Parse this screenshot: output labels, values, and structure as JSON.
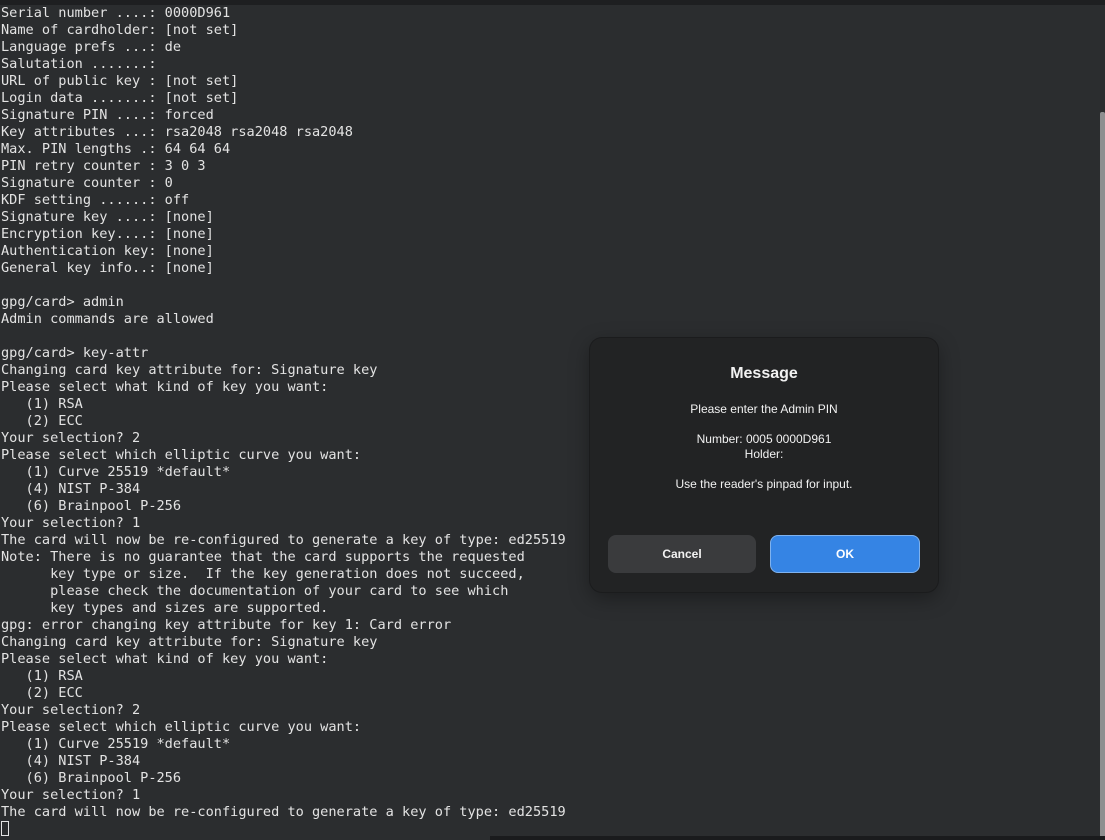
{
  "terminal": {
    "lines": [
      "Serial number ....: 0000D961",
      "Name of cardholder: [not set]",
      "Language prefs ...: de",
      "Salutation .......: ",
      "URL of public key : [not set]",
      "Login data .......: [not set]",
      "Signature PIN ....: forced",
      "Key attributes ...: rsa2048 rsa2048 rsa2048",
      "Max. PIN lengths .: 64 64 64",
      "PIN retry counter : 3 0 3",
      "Signature counter : 0",
      "KDF setting ......: off",
      "Signature key ....: [none]",
      "Encryption key....: [none]",
      "Authentication key: [none]",
      "General key info..: [none]",
      "",
      "gpg/card> admin",
      "Admin commands are allowed",
      "",
      "gpg/card> key-attr",
      "Changing card key attribute for: Signature key",
      "Please select what kind of key you want:",
      "   (1) RSA",
      "   (2) ECC",
      "Your selection? 2",
      "Please select which elliptic curve you want:",
      "   (1) Curve 25519 *default*",
      "   (4) NIST P-384",
      "   (6) Brainpool P-256",
      "Your selection? 1",
      "The card will now be re-configured to generate a key of type: ed25519",
      "Note: There is no guarantee that the card supports the requested",
      "      key type or size.  If the key generation does not succeed,",
      "      please check the documentation of your card to see which",
      "      key types and sizes are supported.",
      "gpg: error changing key attribute for key 1: Card error",
      "Changing card key attribute for: Signature key",
      "Please select what kind of key you want:",
      "   (1) RSA",
      "   (2) ECC",
      "Your selection? 2",
      "Please select which elliptic curve you want:",
      "   (1) Curve 25519 *default*",
      "   (4) NIST P-384",
      "   (6) Brainpool P-256",
      "Your selection? 1",
      "The card will now be re-configured to generate a key of type: ed25519"
    ]
  },
  "dialog": {
    "title": "Message",
    "prompt": "Please enter the Admin PIN",
    "number_line": "Number: 0005 0000D961",
    "holder_line": "Holder: ",
    "pinpad_line": "Use the reader's pinpad for input.",
    "cancel_label": "Cancel",
    "ok_label": "OK"
  }
}
